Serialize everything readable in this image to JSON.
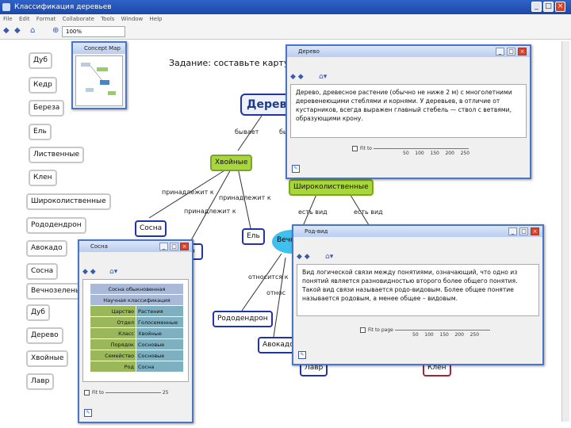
{
  "window": {
    "title": "Классификация деревьев",
    "menu": [
      "File",
      "Edit",
      "Format",
      "Collaborate",
      "Tools",
      "Window",
      "Help"
    ],
    "zoom": "100%"
  },
  "sidebar": {
    "items": [
      "Дуб",
      "Кедр",
      "Береза",
      "Ель",
      "Лиственные",
      "Клен",
      "Широколиственные",
      "Рододендрон",
      "Авокадо",
      "Сосна",
      "Вечнозеленые",
      "Дуб",
      "Дерево",
      "Хвойные",
      "Лавр"
    ]
  },
  "navigator": {
    "title": "Concept Map"
  },
  "map": {
    "task": "Задание: составьте карту из пр",
    "root": "Дерево",
    "nodes": {
      "hvoynye": "Хвойные",
      "shirokolist": "Широколиственные",
      "sosna": "Сосна",
      "el": "Ель",
      "rododendron": "Рододендрон",
      "avokado": "Авокадо",
      "lavr": "Лавр",
      "klen": "Клен",
      "vechno": "Вечнозеленые"
    },
    "links": {
      "byvaet": "бывает",
      "by2": "бы",
      "prinad1": "принадлежит к",
      "prinad2": "принадлежит к",
      "prinad3": "принадлежит к",
      "estvid1": "есть вид",
      "estvid2": "есть вид",
      "otnositsya": "относится к",
      "otnos2": "относ"
    }
  },
  "derevo_window": {
    "title": "Дерево",
    "text": "Дерево, древесное растение (обычно не ниже 2 м) с многолетними деревенеющими стеблями и корнями. У деревьев, в отличие от кустарников, всегда выражен главный стебель — ствол с ветвями, образующими крону.",
    "scale_label": "Fit to",
    "scale_ticks": [
      "50",
      "100",
      "150",
      "200",
      "250"
    ]
  },
  "rodvid_window": {
    "title": "Род-вид",
    "text": "Вид логической связи между понятиями, означающий, что одно из понятий является разновидностью второго более общего понятия. Такой вид связи называется родо-видовым. Более общее понятие называется родовым, а менее общее – видовым.",
    "scale_label": "Fit to page",
    "scale_ticks": [
      "50",
      "100",
      "150",
      "200",
      "250"
    ]
  },
  "sosna_window": {
    "title": "Сосна",
    "header1": "Сосна обыкновенная",
    "header2": "Научная классификация",
    "rows": [
      {
        "k": "Царство",
        "v": "Растения"
      },
      {
        "k": "Отдел",
        "v": "Голосеменные"
      },
      {
        "k": "Класс",
        "v": "Хвойные"
      },
      {
        "k": "Порядок",
        "v": "Сосновые"
      },
      {
        "k": "Семейство",
        "v": "Сосновые"
      },
      {
        "k": "Род",
        "v": "Сосна"
      }
    ],
    "scale_label": "Fit to",
    "scale_end": "25"
  }
}
